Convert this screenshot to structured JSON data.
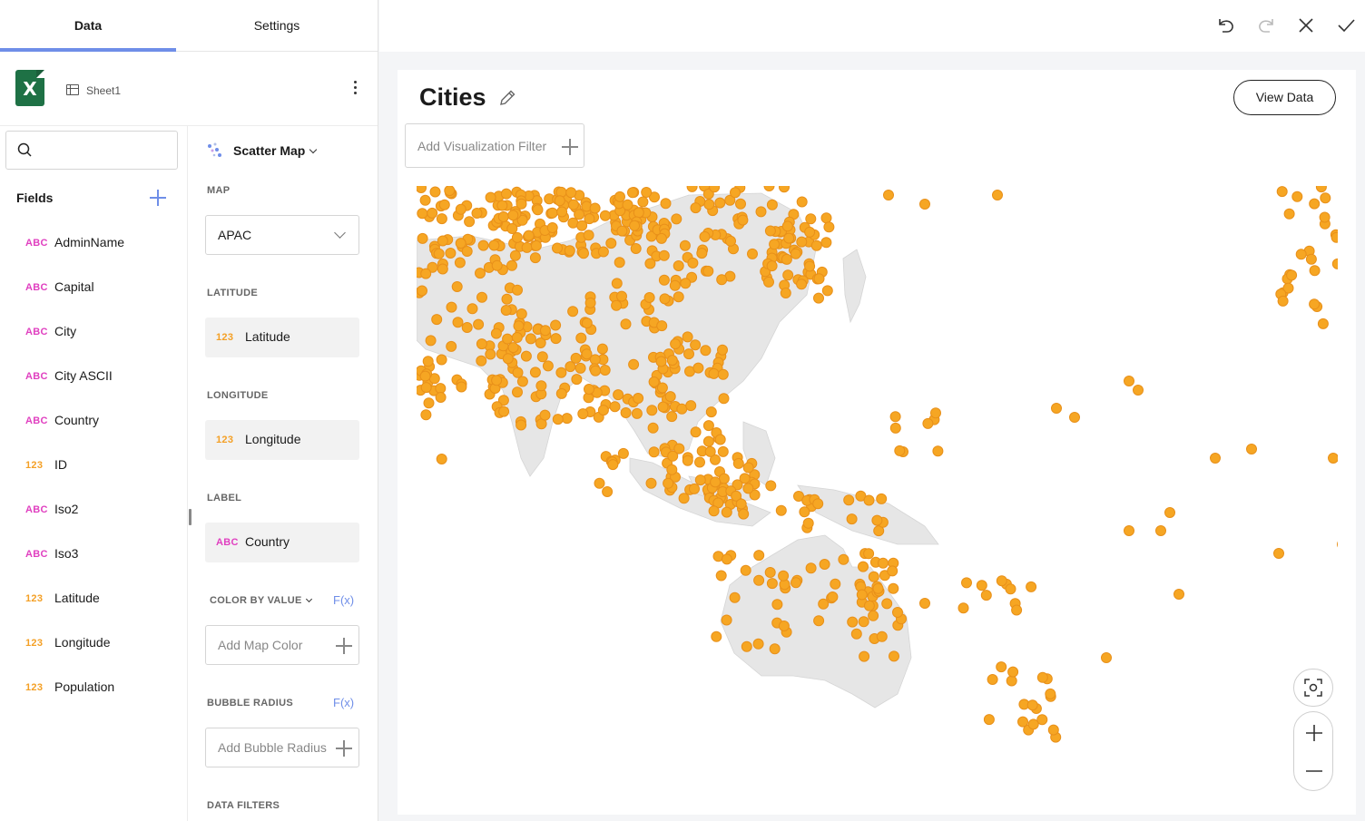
{
  "tabs": {
    "data": "Data",
    "settings": "Settings"
  },
  "source": {
    "icon": "excel-icon",
    "sheet": "Sheet1",
    "icon_letter": "X"
  },
  "fields": {
    "title": "Fields",
    "items": [
      {
        "type": "ABC",
        "name": "AdminName"
      },
      {
        "type": "ABC",
        "name": "Capital"
      },
      {
        "type": "ABC",
        "name": "City"
      },
      {
        "type": "ABC",
        "name": "City ASCII"
      },
      {
        "type": "ABC",
        "name": "Country"
      },
      {
        "type": "123",
        "name": "ID"
      },
      {
        "type": "ABC",
        "name": "Iso2"
      },
      {
        "type": "ABC",
        "name": "Iso3"
      },
      {
        "type": "123",
        "name": "Latitude"
      },
      {
        "type": "123",
        "name": "Longitude"
      },
      {
        "type": "123",
        "name": "Population"
      }
    ]
  },
  "config": {
    "viz_type": "Scatter Map",
    "map_label": "MAP",
    "map_value": "APAC",
    "latitude_label": "LATITUDE",
    "latitude_type": "123",
    "latitude_value": "Latitude",
    "longitude_label": "LONGITUDE",
    "longitude_type": "123",
    "longitude_value": "Longitude",
    "label_label": "LABEL",
    "label_type": "ABC",
    "label_value": "Country",
    "color_by_value": "COLOR BY VALUE",
    "fx": "F(x)",
    "add_map_color": "Add Map Color",
    "bubble_radius": "BUBBLE RADIUS",
    "add_bubble_radius": "Add Bubble Radius",
    "data_filters": "DATA FILTERS"
  },
  "main": {
    "title": "Cities",
    "view_data": "View Data",
    "add_filter": "Add Visualization Filter"
  },
  "colors": {
    "accent": "#6f8ee8",
    "bubble": "#f6a623",
    "bubble_stroke": "#e8901a",
    "land": "#e6e6e6",
    "abc": "#e040c0",
    "num": "#f4a026"
  }
}
